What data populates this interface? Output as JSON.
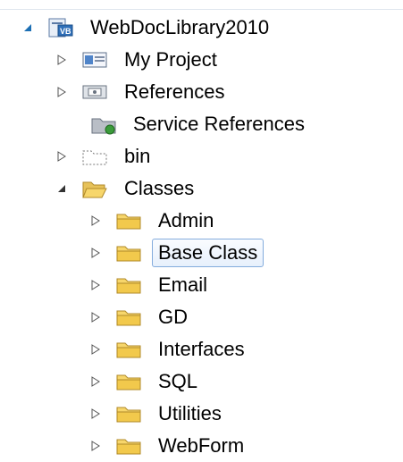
{
  "solution_explorer": {
    "root": {
      "label": "WebDocLibrary2010",
      "icon": "vb-project-icon",
      "expanded": true
    },
    "children": [
      {
        "label": "My Project",
        "icon": "my-project-icon",
        "has_expander": true,
        "expanded": false
      },
      {
        "label": "References",
        "icon": "references-icon",
        "has_expander": true,
        "expanded": false
      },
      {
        "label": "Service References",
        "icon": "service-references-icon",
        "has_expander": false
      },
      {
        "label": "bin",
        "icon": "dotted-folder-icon",
        "has_expander": true,
        "expanded": false
      },
      {
        "label": "Classes",
        "icon": "open-folder-icon",
        "has_expander": true,
        "expanded": true
      }
    ],
    "classes_folders": [
      {
        "label": "Admin",
        "selected": false
      },
      {
        "label": "Base Class",
        "selected": true
      },
      {
        "label": "Email",
        "selected": false
      },
      {
        "label": "GD",
        "selected": false
      },
      {
        "label": "Interfaces",
        "selected": false
      },
      {
        "label": "SQL",
        "selected": false
      },
      {
        "label": "Utilities",
        "selected": false
      },
      {
        "label": "WebForm",
        "selected": false
      }
    ],
    "colors": {
      "folder_fill": "#f7d66b",
      "folder_stroke": "#b08a2a",
      "selection_border": "#84acdd",
      "expanded_arrow": "#1c6fb4"
    }
  }
}
